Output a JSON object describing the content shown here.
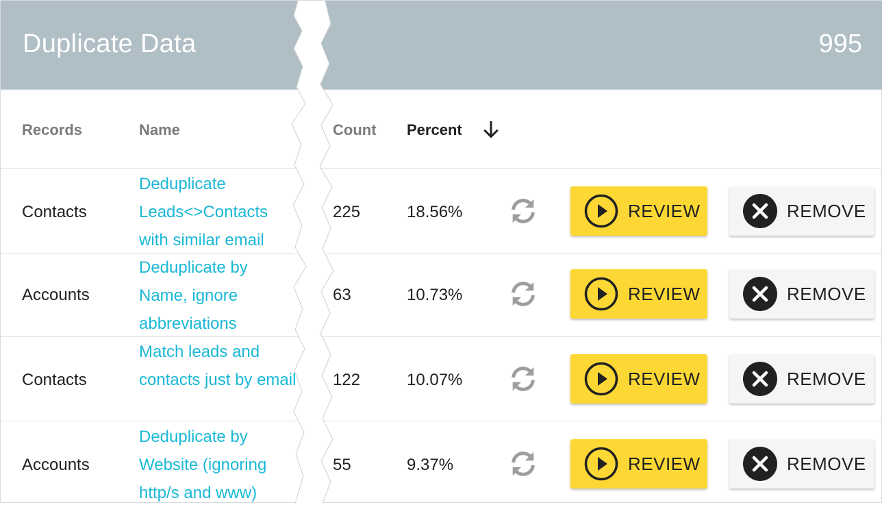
{
  "header": {
    "title": "Duplicate Data",
    "count": "995"
  },
  "columns": {
    "records": "Records",
    "name": "Name",
    "count": "Count",
    "percent": "Percent"
  },
  "rows": [
    {
      "records": "Contacts",
      "name": "Deduplicate Leads<>Contacts with similar email",
      "count": "225",
      "percent": "18.56%",
      "review": "REVIEW",
      "remove": "REMOVE"
    },
    {
      "records": "Accounts",
      "name": "Deduplicate by Name, ignore abbreviations",
      "count": "63",
      "percent": "10.73%",
      "review": "REVIEW",
      "remove": "REMOVE"
    },
    {
      "records": "Contacts",
      "name": "Match leads and contacts just by email",
      "count": "122",
      "percent": "10.07%",
      "review": "REVIEW",
      "remove": "REMOVE"
    },
    {
      "records": "Accounts",
      "name": "Deduplicate by Website (ignoring http/s and www)",
      "count": "55",
      "percent": "9.37%",
      "review": "REVIEW",
      "remove": "REMOVE"
    }
  ],
  "icons": {
    "sort": "arrow-down-icon",
    "refresh": "refresh-icon",
    "review": "play-circle-icon",
    "remove": "close-circle-icon"
  },
  "colors": {
    "header_bg": "#b0bec5",
    "link": "#1ab8d6",
    "review_bg": "#fdd835",
    "remove_bg": "#f5f5f5"
  }
}
